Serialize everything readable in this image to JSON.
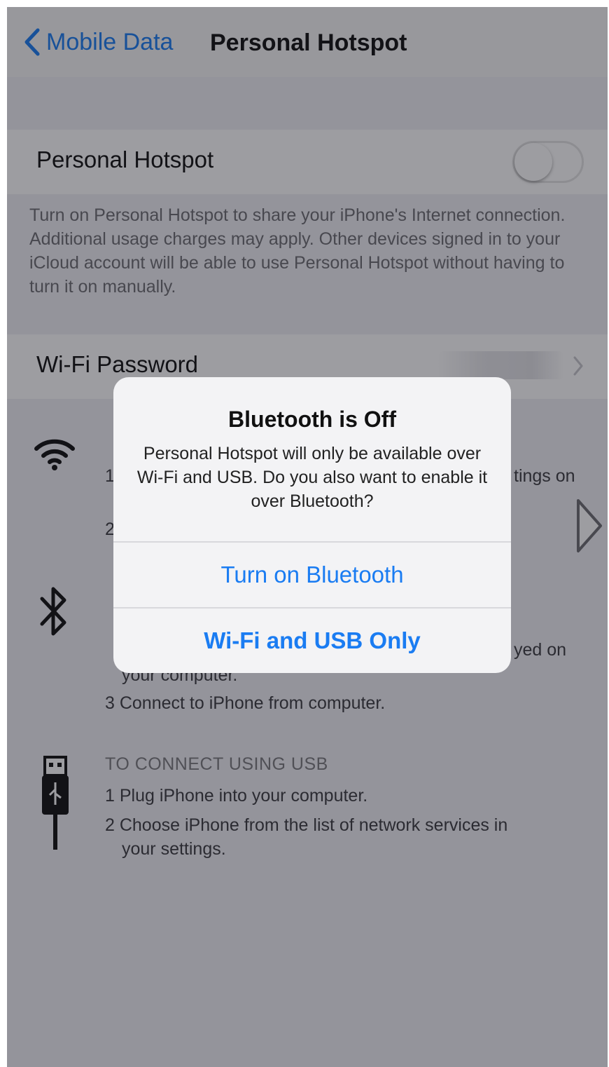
{
  "nav": {
    "back_label": "Mobile Data",
    "title": "Personal Hotspot"
  },
  "hotspot": {
    "label": "Personal Hotspot",
    "enabled": false,
    "footer": "Turn on Personal Hotspot to share your iPhone's Internet connection. Additional usage charges may apply. Other devices signed in to your iCloud account will be able to use Personal Hotspot without having to turn it on manually."
  },
  "wifi_password": {
    "label": "Wi-Fi Password"
  },
  "instructions": {
    "wifi_step1_tail": "1",
    "wifi_step1_suffix": "tings on",
    "wifi_step2_num": "2",
    "bt_step2_suffix": "yed on",
    "bt_step2_cont": "your computer.",
    "bt_step3": "3 Connect to iPhone from computer.",
    "usb_heading": "TO CONNECT USING USB",
    "usb_step1": "1 Plug iPhone into your computer.",
    "usb_step2_line1": "2 Choose iPhone from the list of network services in",
    "usb_step2_line2": "your settings."
  },
  "icons": {
    "wifi": "wifi-icon",
    "bluetooth": "bluetooth-icon",
    "usb": "usb-cable-icon",
    "back": "chevron-left-icon",
    "chevron": "chevron-right-icon",
    "play": "play-arrow-icon"
  },
  "colors": {
    "accent": "#1a7cf2",
    "overlay": "rgba(22,22,32,0.42)"
  },
  "alert": {
    "title": "Bluetooth is Off",
    "message": "Personal Hotspot will only be available over Wi-Fi and USB. Do you also want to enable it over Bluetooth?",
    "primary_button": "Turn on Bluetooth",
    "secondary_button": "Wi-Fi and USB Only"
  }
}
